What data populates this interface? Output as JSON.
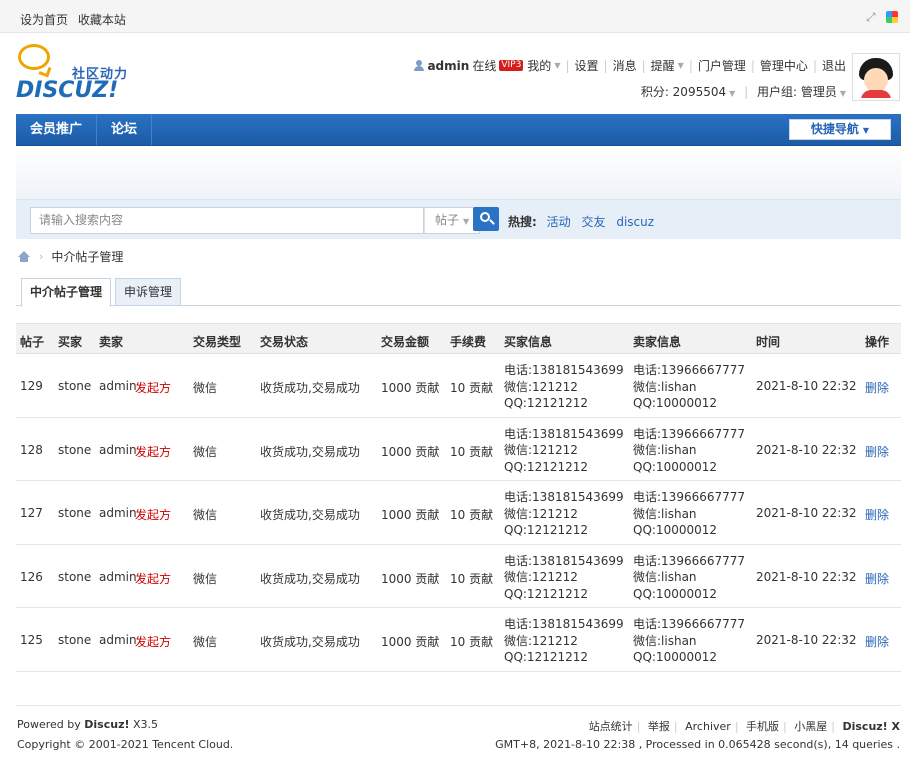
{
  "topbar": {
    "set_home": "设为首页",
    "bookmark": "收藏本站"
  },
  "logo": {
    "cn": "社区动力",
    "en": "DISCUZ!"
  },
  "user": {
    "name": "admin",
    "online": "在线",
    "vip_badge": "VIP3",
    "menu": [
      "我的",
      "设置",
      "消息",
      "提醒",
      "门户管理",
      "管理中心",
      "退出"
    ],
    "points": "积分: 2095504",
    "group": "用户组: 管理员"
  },
  "nav": {
    "items": [
      "会员推广",
      "论坛"
    ],
    "quick_nav": "快捷导航"
  },
  "search": {
    "placeholder": "请输入搜索内容",
    "type": "帖子",
    "hot_label": "热搜:",
    "hot_keywords": [
      "活动",
      "交友",
      "discuz"
    ]
  },
  "breadcrumb": {
    "current": "中介帖子管理"
  },
  "tabs": [
    "中介帖子管理",
    "申诉管理"
  ],
  "table": {
    "headers": [
      "帖子",
      "买家",
      "卖家",
      "交易类型",
      "交易状态",
      "交易金额",
      "手续费",
      "买家信息",
      "卖家信息",
      "时间",
      "操作"
    ],
    "rows": [
      {
        "id": "129",
        "buyer": "stone",
        "seller": "admin",
        "initiator": "发起方",
        "type": "微信",
        "status": "收货成功,交易成功",
        "amount": "1000 贡献",
        "fee": "10 贡献",
        "buyer_info": [
          "电话:138181543699",
          "微信:121212",
          "QQ:12121212"
        ],
        "seller_info": [
          "电话:13966667777",
          "微信:lishan",
          "QQ:10000012"
        ],
        "time": "2021-8-10 22:32",
        "action": "删除"
      },
      {
        "id": "128",
        "buyer": "stone",
        "seller": "admin",
        "initiator": "发起方",
        "type": "微信",
        "status": "收货成功,交易成功",
        "amount": "1000 贡献",
        "fee": "10 贡献",
        "buyer_info": [
          "电话:138181543699",
          "微信:121212",
          "QQ:12121212"
        ],
        "seller_info": [
          "电话:13966667777",
          "微信:lishan",
          "QQ:10000012"
        ],
        "time": "2021-8-10 22:32",
        "action": "删除"
      },
      {
        "id": "127",
        "buyer": "stone",
        "seller": "admin",
        "initiator": "发起方",
        "type": "微信",
        "status": "收货成功,交易成功",
        "amount": "1000 贡献",
        "fee": "10 贡献",
        "buyer_info": [
          "电话:138181543699",
          "微信:121212",
          "QQ:12121212"
        ],
        "seller_info": [
          "电话:13966667777",
          "微信:lishan",
          "QQ:10000012"
        ],
        "time": "2021-8-10 22:32",
        "action": "删除"
      },
      {
        "id": "126",
        "buyer": "stone",
        "seller": "admin",
        "initiator": "发起方",
        "type": "微信",
        "status": "收货成功,交易成功",
        "amount": "1000 贡献",
        "fee": "10 贡献",
        "buyer_info": [
          "电话:138181543699",
          "微信:121212",
          "QQ:12121212"
        ],
        "seller_info": [
          "电话:13966667777",
          "微信:lishan",
          "QQ:10000012"
        ],
        "time": "2021-8-10 22:32",
        "action": "删除"
      },
      {
        "id": "125",
        "buyer": "stone",
        "seller": "admin",
        "initiator": "发起方",
        "type": "微信",
        "status": "收货成功,交易成功",
        "amount": "1000 贡献",
        "fee": "10 贡献",
        "buyer_info": [
          "电话:138181543699",
          "微信:121212",
          "QQ:12121212"
        ],
        "seller_info": [
          "电话:13966667777",
          "微信:lishan",
          "QQ:10000012"
        ],
        "time": "2021-8-10 22:32",
        "action": "删除"
      }
    ]
  },
  "footer": {
    "powered_prefix": "Powered by",
    "powered_brand": "Discuz!",
    "powered_version": "X3.5",
    "copyright": "Copyright © 2001-2021 Tencent Cloud.",
    "links": [
      "站点统计",
      "举报",
      "Archiver",
      "手机版",
      "小黑屋"
    ],
    "brand": "Discuz! X",
    "stats": "GMT+8, 2021-8-10 22:38 , Processed in 0.065428 second(s), 14 queries ."
  },
  "colors": {
    "accent": "#2a72c5",
    "link": "#2966b8",
    "initiator": "#cc0000"
  }
}
